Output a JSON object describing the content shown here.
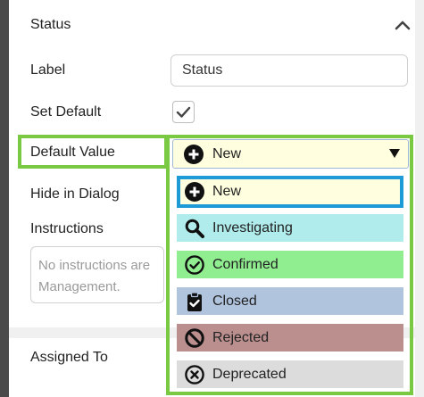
{
  "panel": {
    "title": "Status"
  },
  "fields": {
    "label_label": "Label",
    "label_value": "Status",
    "set_default_label": "Set Default",
    "set_default_checked": true,
    "default_value_label": "Default Value",
    "hide_in_dialog_label": "Hide in Dialog",
    "instructions_label": "Instructions",
    "instructions_placeholder_line1": "No instructions are",
    "instructions_placeholder_line2": "Management."
  },
  "default_value_select": {
    "selected_label": "New",
    "selected_icon": "plus-circle-icon"
  },
  "dropdown_options": [
    {
      "label": "New",
      "icon": "plus-circle-icon",
      "color": "#ffffe0"
    },
    {
      "label": "Investigating",
      "icon": "search-icon",
      "color": "#b0ecec"
    },
    {
      "label": "Confirmed",
      "icon": "check-circle-icon",
      "color": "#90ee90"
    },
    {
      "label": "Closed",
      "icon": "clipboard-check-icon",
      "color": "#b0c4de"
    },
    {
      "label": "Rejected",
      "icon": "ban-icon",
      "color": "#bc8f8f"
    },
    {
      "label": "Deprecated",
      "icon": "x-circle-icon",
      "color": "#dcdcdc"
    }
  ],
  "next_panel": {
    "title": "Assigned To"
  },
  "colors": {
    "highlight_green": "#7ac943",
    "highlight_blue": "#1e9ad6"
  }
}
